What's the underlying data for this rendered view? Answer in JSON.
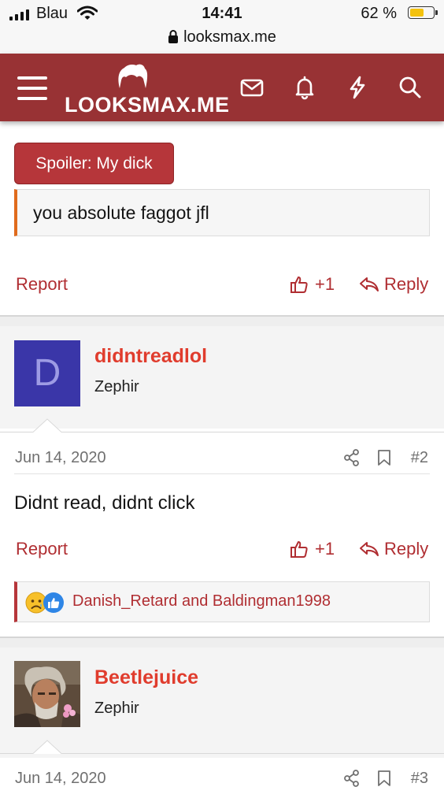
{
  "status_bar": {
    "carrier": "Blau",
    "time": "14:41",
    "battery_percent": "62 %",
    "battery_level": 0.62,
    "url": "looksmax.me"
  },
  "header": {
    "logo_text": "LOOKSMAX.ME",
    "icons": [
      "menu-icon",
      "mail-icon",
      "bell-icon",
      "lightning-icon",
      "search-icon"
    ],
    "background_color": "#983234"
  },
  "post_1": {
    "spoiler_button_label": "Spoiler: My dick",
    "spoiler_text": "you absolute faggot jfl",
    "report_label": "Report",
    "like_count": "+1",
    "reply_label": "Reply"
  },
  "post_2": {
    "avatar_letter": "D",
    "username": "didntreadlol",
    "user_title": "Zephir",
    "date": "Jun 14, 2020",
    "post_number": "#2",
    "body": "Didnt read, didnt click",
    "report_label": "Report",
    "like_count": "+1",
    "reply_label": "Reply",
    "reactions_text": "Danish_Retard and Baldingman1998"
  },
  "post_3": {
    "username": "Beetlejuice",
    "user_title": "Zephir",
    "date": "Jun 14, 2020",
    "post_number": "#3"
  },
  "colors": {
    "accent": "#b02e32",
    "username": "#e03c2d",
    "quote_border": "#e06b1c"
  }
}
